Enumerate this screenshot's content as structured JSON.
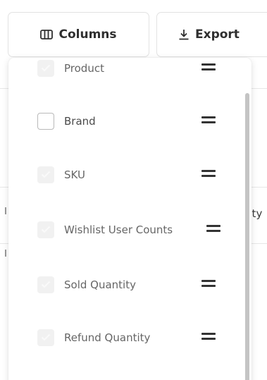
{
  "toolbar": {
    "columns_label": "Columns",
    "export_label": "Export",
    "columns_icon": "columns-icon",
    "export_icon": "download-icon"
  },
  "background": {
    "partial_column_text": "tity"
  },
  "columns_menu": {
    "items": [
      {
        "label": "Product",
        "checked": true,
        "disabled": true
      },
      {
        "label": "Brand",
        "checked": false,
        "disabled": false
      },
      {
        "label": "SKU",
        "checked": true,
        "disabled": true
      },
      {
        "label": "Wishlist User Counts",
        "checked": true,
        "disabled": true
      },
      {
        "label": "Sold Quantity",
        "checked": true,
        "disabled": true
      },
      {
        "label": "Refund Quantity",
        "checked": true,
        "disabled": true
      }
    ],
    "drag_icon": "drag-handle-icon"
  },
  "colors": {
    "border": "#e2e2e2",
    "checkbox_disabled": "#f1f1f1",
    "scroll_thumb": "#c4c4c4",
    "text": "#2f2f2f"
  }
}
